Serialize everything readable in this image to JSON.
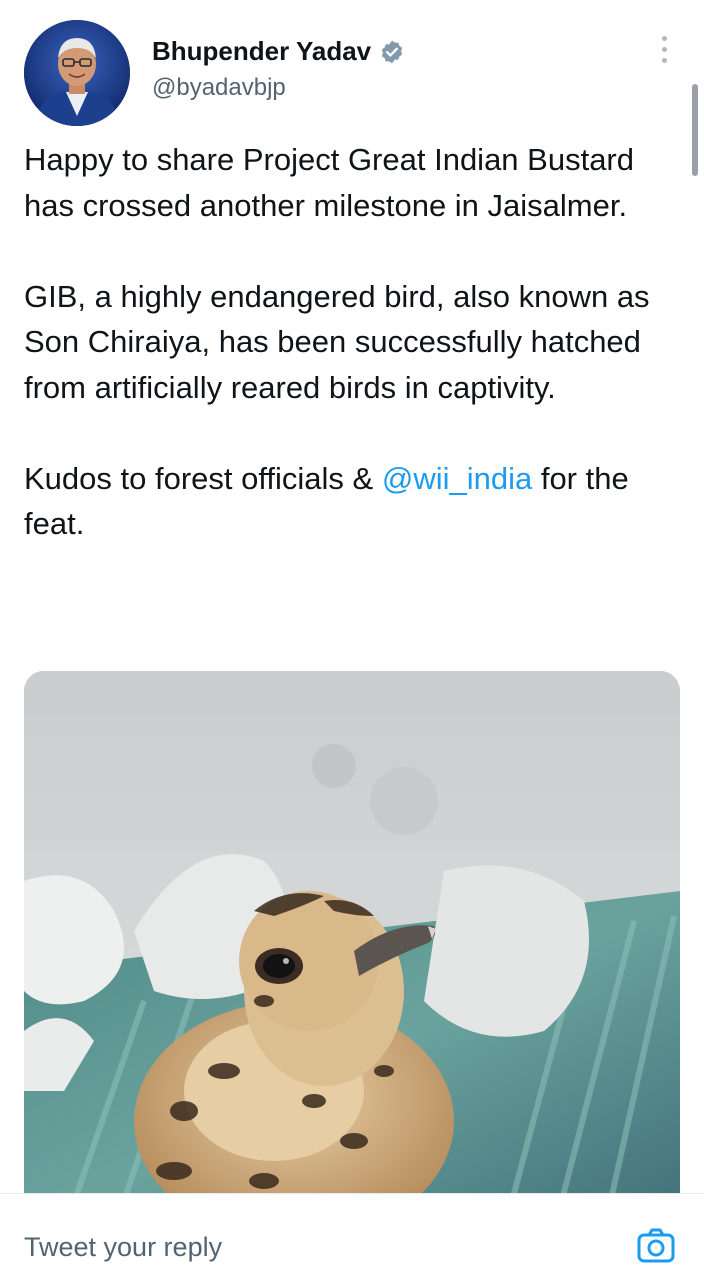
{
  "author": {
    "name": "Bhupender Yadav",
    "handle": "@byadavbjp",
    "verified_icon": "verified-badge-icon"
  },
  "tweet": {
    "paragraph1": "Happy to share Project Great Indian Bustard has crossed another milestone in Jaisalmer.",
    "paragraph2": "GIB, a highly endangered bird, also known as Son Chiraiya, has been successfully hatched from artificially reared birds in captivity.",
    "paragraph3_before": "Kudos to forest officials & ",
    "paragraph3_mention": "@wii_india",
    "paragraph3_after": " for the feat."
  },
  "reply": {
    "placeholder": "Tweet your reply",
    "camera_icon": "camera-icon"
  },
  "colors": {
    "link": "#1d9bf0",
    "verified": "#829aab",
    "text": "#0f1419",
    "secondary": "#536471"
  }
}
